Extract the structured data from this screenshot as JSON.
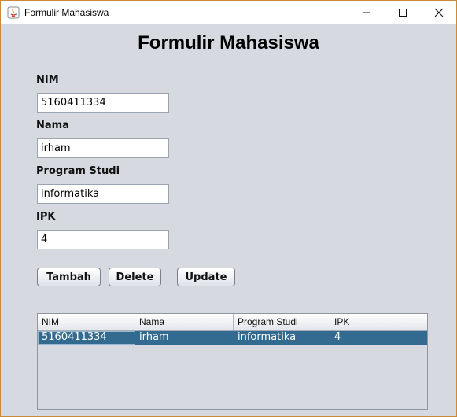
{
  "window": {
    "title": "Formulir Mahasiswa",
    "border_color": "#c98a3a",
    "controls": [
      "minimize-icon",
      "maximize-icon",
      "close-icon"
    ]
  },
  "form": {
    "heading": "Formulir Mahasiswa",
    "fields": {
      "nim": {
        "label": "NIM",
        "value": "5160411334"
      },
      "nama": {
        "label": "Nama",
        "value": "irham"
      },
      "prodi": {
        "label": "Program Studi",
        "value": "informatika"
      },
      "ipk": {
        "label": "IPK",
        "value": "4"
      }
    },
    "buttons": {
      "tambah": "Tambah",
      "delete": "Delete",
      "update": "Update"
    }
  },
  "table": {
    "columns": [
      "NIM",
      "Nama",
      "Program Studi",
      "IPK"
    ],
    "rows": [
      [
        "5160411334",
        "irham",
        "informatika",
        "4"
      ]
    ],
    "selected_row_color": "#336a8f"
  }
}
